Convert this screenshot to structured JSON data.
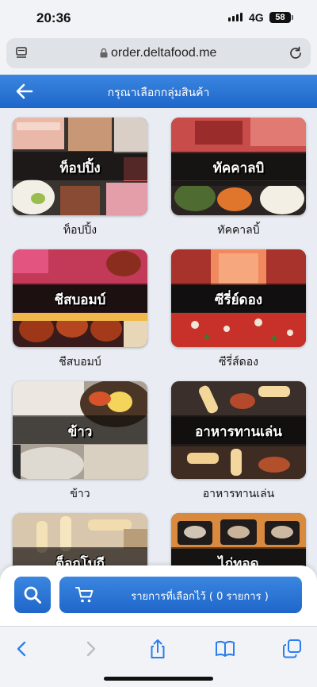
{
  "status_bar": {
    "time": "20:36",
    "network": "4G",
    "battery": "58"
  },
  "browser": {
    "url": "order.deltafood.me"
  },
  "header": {
    "title": "กรุณาเลือกกลุ่มสินค้า"
  },
  "categories": [
    {
      "banner": "ท็อปปิ้ง",
      "caption": "ท็อปปิ้ง"
    },
    {
      "banner": "ทัคคาลบิ",
      "caption": "ทัคคาลบิ้"
    },
    {
      "banner": "ชีสบอมบ์",
      "caption": "ชีสบอมบ์"
    },
    {
      "banner": "ซีรี่ย์ดอง",
      "caption": "ซีรี่ส์ดอง"
    },
    {
      "banner": "ข้าว",
      "caption": "ข้าว"
    },
    {
      "banner": "อาหารทานเล่น",
      "caption": "อาหารทานเล่น"
    },
    {
      "banner": "ต็อกโบกี",
      "caption": ""
    },
    {
      "banner": "ไก่ทอด",
      "caption": ""
    }
  ],
  "cart": {
    "label": "รายการที่เลือกไว้ ( 0 รายการ )"
  },
  "icons": {
    "back": "arrow-left-icon",
    "search": "search-icon",
    "cart": "cart-icon",
    "reader": "reader-icon",
    "lock": "lock-icon",
    "reload": "reload-icon",
    "nav_back": "chevron-left-icon",
    "nav_forward": "chevron-right-icon",
    "share": "share-icon",
    "bookmarks": "book-icon",
    "tabs": "tabs-icon"
  },
  "colors": {
    "accent": "#2574d6",
    "background": "#e9edf3"
  }
}
